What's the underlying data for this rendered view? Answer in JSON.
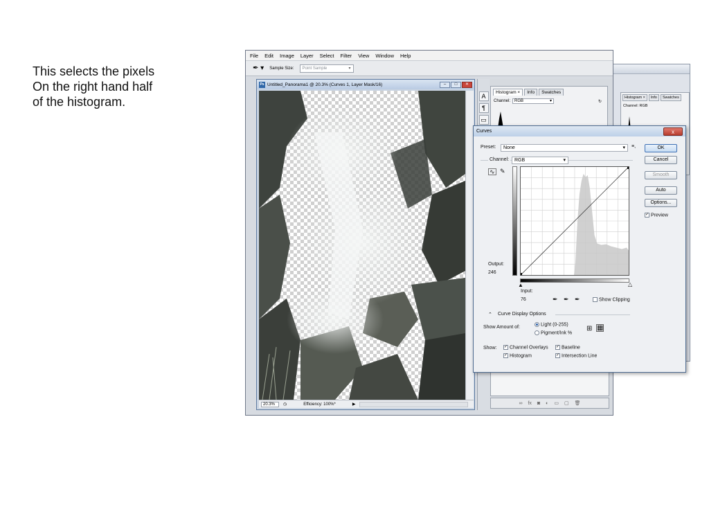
{
  "slide": {
    "lines": [
      "This selects the pixels",
      "On the right hand half",
      "of the histogram."
    ]
  },
  "menu": [
    "File",
    "Edit",
    "Image",
    "Layer",
    "Select",
    "Filter",
    "View",
    "Window",
    "Help"
  ],
  "options_bar": {
    "sample_size_label": "Sample Size:",
    "sample_size_value": "Point Sample"
  },
  "document": {
    "title": "Untitled_Panorama1 @ 20.3% (Curves 1, Layer Mask/16)",
    "zoom": "20.3%",
    "efficiency": "Efficiency: 100%*"
  },
  "histogram_panel": {
    "tabs": [
      "Histogram ×",
      "Info",
      "Swatches"
    ],
    "channel_label": "Channel:",
    "channel_value": "RGB"
  },
  "bg_panel": {
    "tabs": [
      "Histogram ×",
      "Info",
      "Swatches"
    ],
    "channel": "Channel:  RGB"
  },
  "curves": {
    "title": "Curves",
    "close": "x",
    "preset_label": "Preset:",
    "preset_value": "None",
    "channel_label": "Channel:",
    "channel_value": "RGB",
    "buttons": {
      "ok": "OK",
      "cancel": "Cancel",
      "smooth": "Smooth",
      "auto": "Auto",
      "options": "Options..."
    },
    "preview_label": "Preview",
    "output_label": "Output:",
    "output_value": "246",
    "input_label": "Input:",
    "input_value": "76",
    "show_clipping": "Show Clipping",
    "display_options": "Curve Display Options",
    "show_amount_label": "Show Amount of:",
    "light_option": "Light  (0-255)",
    "pigment_option": "Pigment/Ink %",
    "show_label": "Show:",
    "channel_overlays": "Channel Overlays",
    "baseline": "Baseline",
    "histogram": "Histogram",
    "intersection_line": "Intersection Line"
  }
}
